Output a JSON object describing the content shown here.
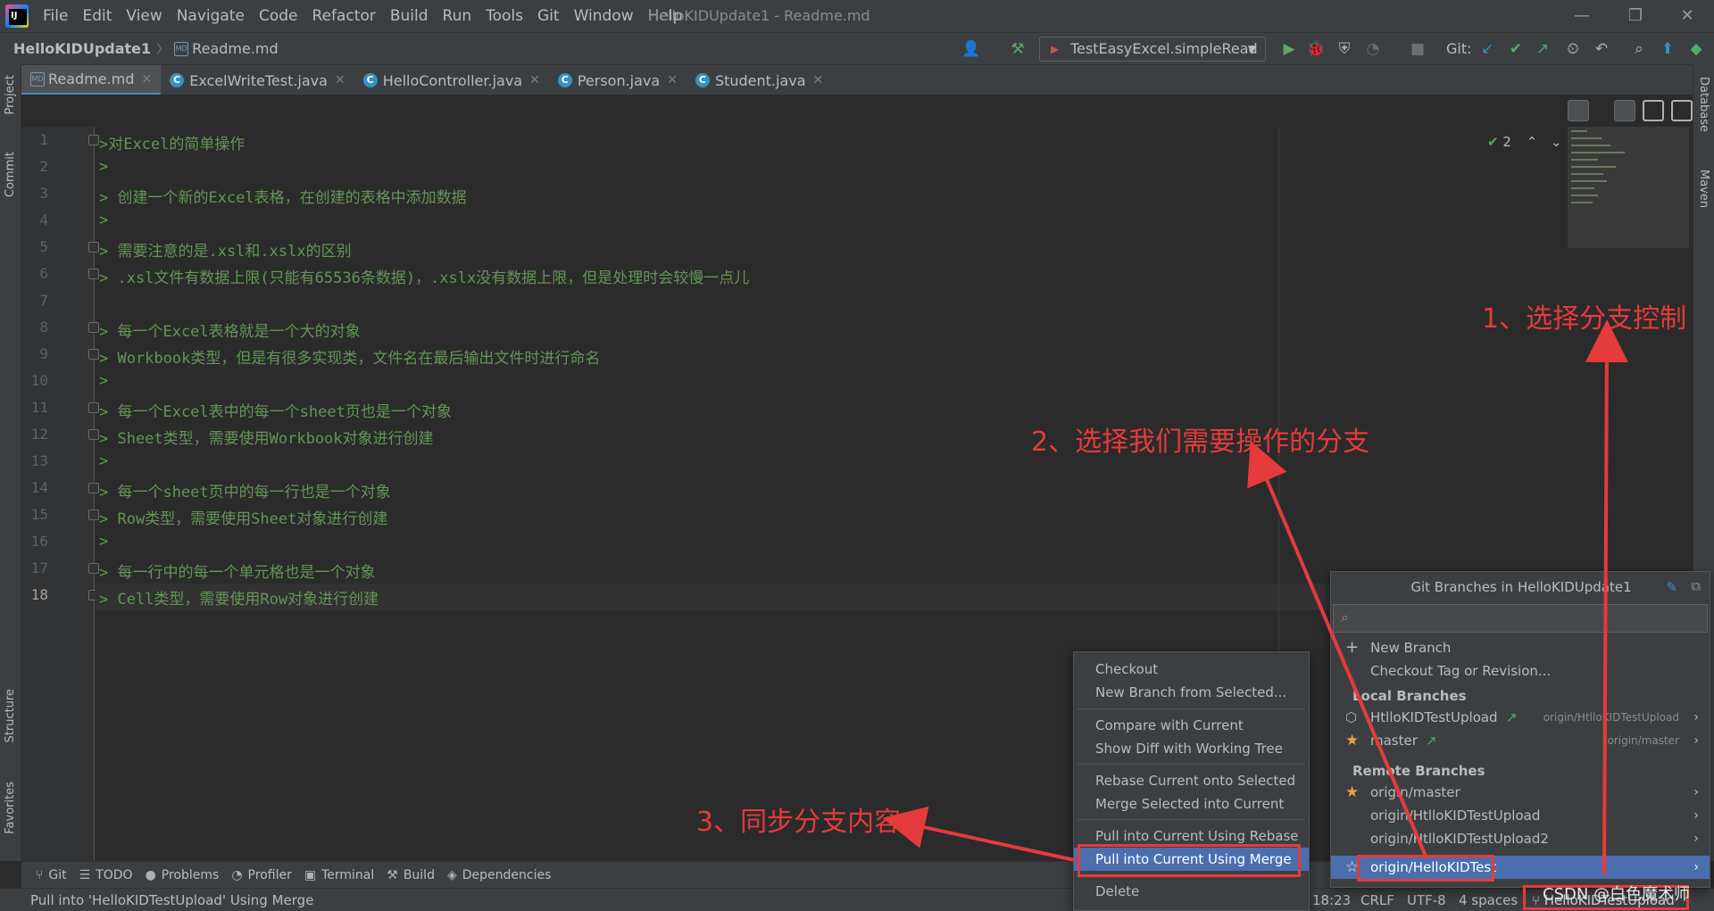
{
  "menubar": {
    "items": [
      "File",
      "Edit",
      "View",
      "Navigate",
      "Code",
      "Refactor",
      "Build",
      "Run",
      "Tools",
      "Git",
      "Window",
      "Help"
    ],
    "window_title": "HelloKIDUpdate1 - Readme.md"
  },
  "navbar": {
    "project": "HelloKIDUpdate1",
    "file": "Readme.md",
    "run_config": "TestEasyExcel.simpleRead",
    "git_label": "Git:"
  },
  "tabs": [
    {
      "label": "Readme.md",
      "icon": "markdown-icon"
    },
    {
      "label": "ExcelWriteTest.java",
      "icon": "class-icon"
    },
    {
      "label": "HelloController.java",
      "icon": "class-icon"
    },
    {
      "label": "Person.java",
      "icon": "class-icon"
    },
    {
      "label": "Student.java",
      "icon": "class-icon"
    }
  ],
  "left_stripe": {
    "project": "Project",
    "commit": "Commit",
    "structure": "Structure",
    "favorites": "Favorites"
  },
  "right_stripe": {
    "database": "Database",
    "maven": "Maven"
  },
  "editor": {
    "inspection_count": "2",
    "line_numbers": [
      "1",
      "2",
      "3",
      "4",
      "5",
      "6",
      "7",
      "8",
      "9",
      "10",
      "11",
      "12",
      "13",
      "14",
      "15",
      "16",
      "17",
      "18"
    ],
    "lines": [
      ">对Excel的简单操作",
      ">",
      "> 创建一个新的Excel表格，在创建的表格中添加数据",
      ">",
      "> 需要注意的是.xsl和.xslx的区别",
      "> .xsl文件有数据上限(只能有65536条数据)，.xslx没有数据上限，但是处理时会较慢一点儿",
      "",
      "> 每一个Excel表格就是一个大的对象",
      "> Workbook类型，但是有很多实现类，文件名在最后输出文件时进行命名",
      ">",
      "> 每一个Excel表中的每一个sheet页也是一个对象",
      "> Sheet类型，需要使用Workbook对象进行创建",
      ">",
      "> 每一个sheet页中的每一行也是一个对象",
      "> Row类型，需要使用Sheet对象进行创建",
      ">",
      "> 每一行中的每一个单元格也是一个对象",
      "> Cell类型，需要使用Row对象进行创建"
    ]
  },
  "bottom_tools": [
    "Git",
    "TODO",
    "Problems",
    "Profiler",
    "Terminal",
    "Build",
    "Dependencies"
  ],
  "status": {
    "message": "Pull into 'HelloKIDTestUpload' Using Merge",
    "position": "18:23",
    "line_sep": "CRLF",
    "encoding": "UTF-8",
    "indent": "4 spaces",
    "branch": "HelloKIDTestUpload"
  },
  "git_popup": {
    "title": "Git Branches in HelloKIDUpdate1",
    "new_branch": "New Branch",
    "checkout_tag": "Checkout Tag or Revision...",
    "local_header": "Local Branches",
    "local": [
      {
        "name": "HtlloKIDTestUpload",
        "tracking": "origin/HtlloKIDTestUpload"
      },
      {
        "name": "master",
        "tracking": "origin/master"
      }
    ],
    "remote_header": "Remote Branches",
    "remote": [
      "origin/master",
      "origin/HtlloKIDTestUpload",
      "origin/HtlloKIDTestUpload2",
      "origin/HelloKIDTest"
    ]
  },
  "context_menu": {
    "items": [
      "Checkout",
      "New Branch from Selected...",
      "Compare with Current",
      "Show Diff with Working Tree",
      "Rebase Current onto Selected",
      "Merge Selected into Current",
      "Pull into Current Using Rebase",
      "Pull into Current Using Merge",
      "Delete"
    ]
  },
  "annotations": {
    "step1": "1、选择分支控制",
    "step2": "2、选择我们需要操作的分支",
    "step3": "3、同步分支内容",
    "color": "#e53b3b"
  },
  "watermark": "CSDN @白色魔术师"
}
